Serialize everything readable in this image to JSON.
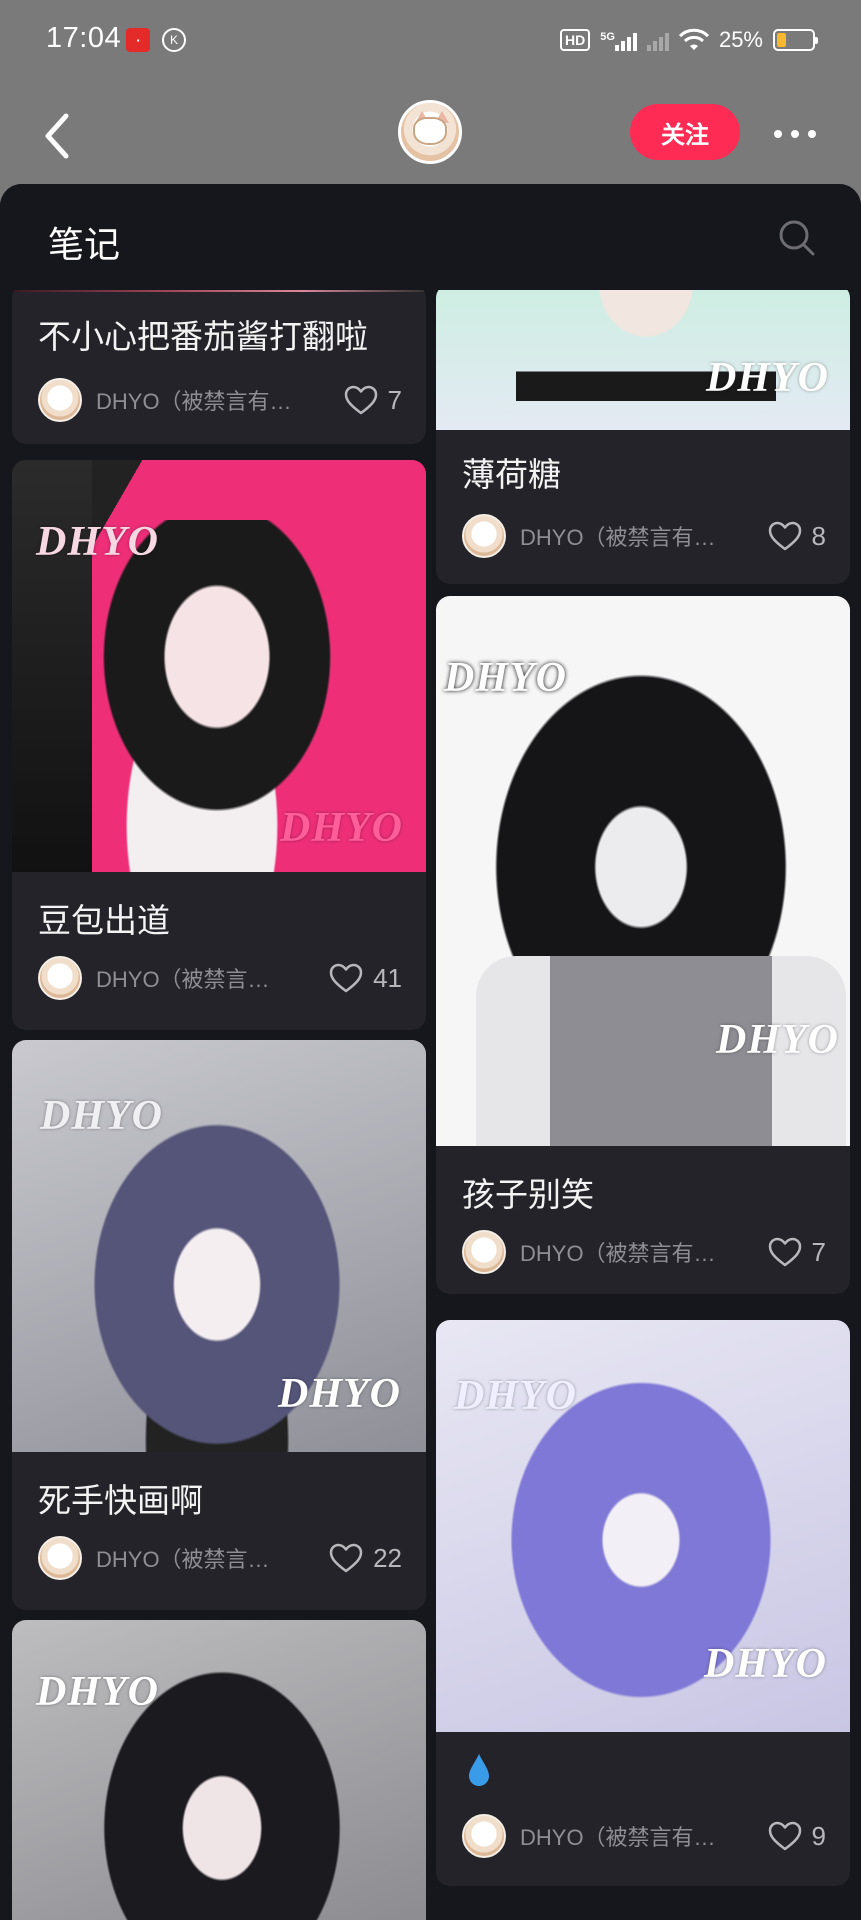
{
  "status_bar": {
    "time": "17:04",
    "k_badge": "K",
    "hd_badge": "HD",
    "network": "5G",
    "battery": "25%",
    "battery_level": 0.25
  },
  "header": {
    "follow_label": "关注"
  },
  "sheet": {
    "title": "笔记"
  },
  "watermark": "DHYO",
  "author": "DHYO（被禁言有…",
  "author_short": "DHYO（被禁言…",
  "cards_left": [
    {
      "title": "不小心把番茄酱打翻啦",
      "author": "DHYO（被禁言有…",
      "likes": "7"
    },
    {
      "title": "豆包出道",
      "author": "DHYO（被禁言…",
      "likes": "41"
    },
    {
      "title": "死手快画啊",
      "author": "DHYO（被禁言…",
      "likes": "22"
    },
    {
      "title": "",
      "author": "",
      "likes": ""
    }
  ],
  "cards_right": [
    {
      "title": "薄荷糖",
      "author": "DHYO（被禁言有…",
      "likes": "8"
    },
    {
      "title": "孩子别笑",
      "author": "DHYO（被禁言有…",
      "likes": "7"
    },
    {
      "title": "",
      "author": "DHYO（被禁言有…",
      "likes": "9",
      "title_icon": "water-drop-icon"
    }
  ],
  "colors": {
    "accent": "#fe2c55",
    "sheet_bg": "#16161d",
    "card_bg": "#232329",
    "overlay": "#7a7a7a"
  }
}
